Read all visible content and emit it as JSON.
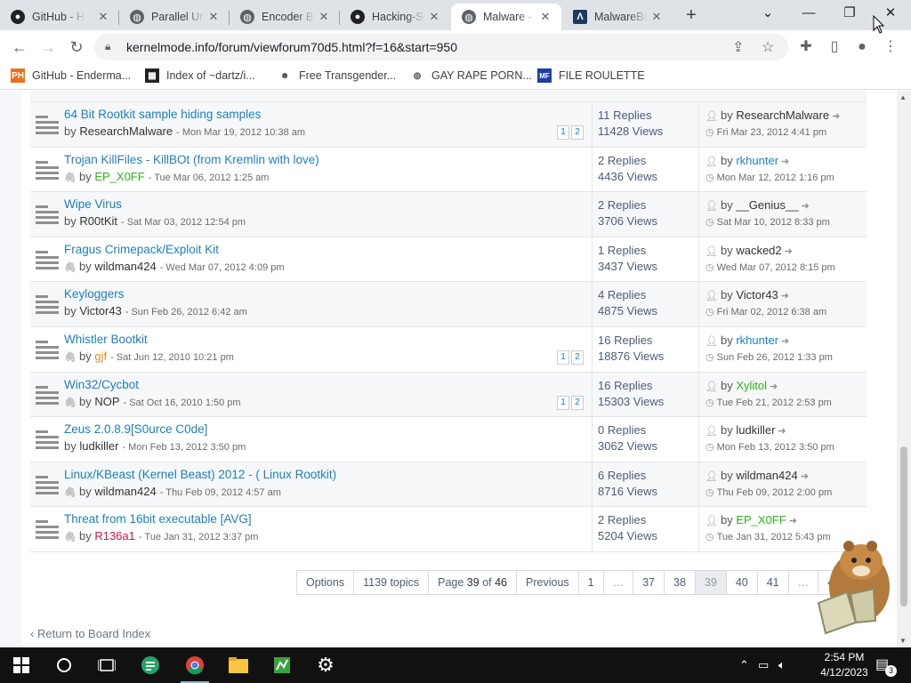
{
  "browser": {
    "tabs": [
      {
        "label": "GitHub - H",
        "icon": "github-icon"
      },
      {
        "label": "Parallel Un",
        "icon": "globe-icon"
      },
      {
        "label": "Encoder Bo",
        "icon": "globe-icon"
      },
      {
        "label": "Hacking-S",
        "icon": "github-icon"
      },
      {
        "label": "Malware -",
        "icon": "globe-icon"
      },
      {
        "label": "MalwareBa",
        "icon": "malwarebazaar-icon"
      }
    ],
    "active_tab_index": 4,
    "url": "kernelmode.info/forum/viewforum70d5.html?f=16&start=950",
    "bookmarks": [
      {
        "label": "GitHub - Enderma...",
        "icon": "ph-icon"
      },
      {
        "label": "Index of ~dartz/i...",
        "icon": "qr-icon"
      },
      {
        "label": "Free Transgender...",
        "icon": "mask-icon"
      },
      {
        "label": "GAY RAPE PORN...",
        "icon": "globe-icon"
      },
      {
        "label": "FILE ROULETTE",
        "icon": "mf-icon"
      }
    ]
  },
  "forum": {
    "topics": [
      {
        "title": "64 Bit Rootkit sample hiding samples",
        "attachment": false,
        "by": "by",
        "author": "ResearchMalware",
        "author_color": "#333333",
        "date": "- Mon Mar 19, 2012 10:38 am",
        "pages": [
          "1",
          "2"
        ],
        "replies": "11 Replies",
        "views": "11428 Views",
        "last_by": "by",
        "last_user": "ResearchMalware",
        "last_user_color": "#333333",
        "last_date": "Fri Mar 23, 2012 4:41 pm"
      },
      {
        "title": "Trojan KillFiles - KillBOt (from Kremlin with love)",
        "attachment": true,
        "by": "by",
        "author": "EP_X0FF",
        "author_color": "#2bb21c",
        "date": "- Tue Mar 06, 2012 1:25 am",
        "pages": [],
        "replies": "2 Replies",
        "views": "4436 Views",
        "last_by": "by",
        "last_user": "rkhunter",
        "last_user_color": "#1f7ebd",
        "last_date": "Mon Mar 12, 2012 1:16 pm"
      },
      {
        "title": "Wipe Virus",
        "attachment": false,
        "by": "by",
        "author": "R00tKit",
        "author_color": "#333333",
        "date": "- Sat Mar 03, 2012 12:54 pm",
        "pages": [],
        "replies": "2 Replies",
        "views": "3706 Views",
        "last_by": "by",
        "last_user": "__Genius__",
        "last_user_color": "#333333",
        "last_date": "Sat Mar 10, 2012 8:33 pm"
      },
      {
        "title": "Fragus Crimepack/Exploit Kit",
        "attachment": true,
        "by": "by",
        "author": "wildman424",
        "author_color": "#333333",
        "date": "- Wed Mar 07, 2012 4:09 pm",
        "pages": [],
        "replies": "1 Replies",
        "views": "3437 Views",
        "last_by": "by",
        "last_user": "wacked2",
        "last_user_color": "#333333",
        "last_date": "Wed Mar 07, 2012 8:15 pm"
      },
      {
        "title": "Keyloggers",
        "attachment": false,
        "by": "by",
        "author": "Victor43",
        "author_color": "#333333",
        "date": "- Sun Feb 26, 2012 6:42 am",
        "pages": [],
        "replies": "4 Replies",
        "views": "4875 Views",
        "last_by": "by",
        "last_user": "Victor43",
        "last_user_color": "#333333",
        "last_date": "Fri Mar 02, 2012 6:38 am"
      },
      {
        "title": "Whistler Bootkit",
        "attachment": true,
        "by": "by",
        "author": "gjf",
        "author_color": "#ec8a2b",
        "date": "- Sat Jun 12, 2010 10:21 pm",
        "pages": [
          "1",
          "2"
        ],
        "replies": "16 Replies",
        "views": "18876 Views",
        "last_by": "by",
        "last_user": "rkhunter",
        "last_user_color": "#1f7ebd",
        "last_date": "Sun Feb 26, 2012 1:33 pm"
      },
      {
        "title": "Win32/Cycbot",
        "attachment": true,
        "by": "by",
        "author": "NOP",
        "author_color": "#333333",
        "date": "- Sat Oct 16, 2010 1:50 pm",
        "pages": [
          "1",
          "2"
        ],
        "replies": "16 Replies",
        "views": "15303 Views",
        "last_by": "by",
        "last_user": "Xylitol",
        "last_user_color": "#2bb21c",
        "last_date": "Tue Feb 21, 2012 2:53 pm"
      },
      {
        "title": "Zeus 2.0.8.9[S0urce C0de]",
        "attachment": false,
        "by": "by",
        "author": "ludkiller",
        "author_color": "#333333",
        "date": "- Mon Feb 13, 2012 3:50 pm",
        "pages": [],
        "replies": "0 Replies",
        "views": "3062 Views",
        "last_by": "by",
        "last_user": "ludkiller",
        "last_user_color": "#333333",
        "last_date": "Mon Feb 13, 2012 3:50 pm"
      },
      {
        "title": "Linux/KBeast (Kernel Beast) 2012 - ( Linux Rootkit)",
        "attachment": true,
        "by": "by",
        "author": "wildman424",
        "author_color": "#333333",
        "date": "- Thu Feb 09, 2012 4:57 am",
        "pages": [],
        "replies": "6 Replies",
        "views": "8716 Views",
        "last_by": "by",
        "last_user": "wildman424",
        "last_user_color": "#333333",
        "last_date": "Thu Feb 09, 2012 2:00 pm"
      },
      {
        "title": "Threat from 16bit executable [AVG]",
        "attachment": true,
        "by": "by",
        "author": "R136a1",
        "author_color": "#d31141",
        "date": "- Tue Jan 31, 2012 3:37 pm",
        "pages": [],
        "replies": "2 Replies",
        "views": "5204 Views",
        "last_by": "by",
        "last_user": "EP_X0FF",
        "last_user_color": "#2bb21c",
        "last_date": "Tue Jan 31, 2012 5:43 pm"
      }
    ],
    "pagination": {
      "options_label": "Options",
      "topics_count": "1139 topics",
      "page_prefix": "Page",
      "current_page": "39",
      "page_of": "of",
      "total_pages": "46",
      "previous_label": "Previous",
      "items": [
        "1",
        "…",
        "37",
        "38",
        "39",
        "40",
        "41",
        "…",
        "46"
      ]
    },
    "return_link": "Return to Board Index"
  },
  "taskbar": {
    "time": "2:54 PM",
    "date": "4/12/2023",
    "notifications": "3",
    "accent": "#76b9ed"
  }
}
